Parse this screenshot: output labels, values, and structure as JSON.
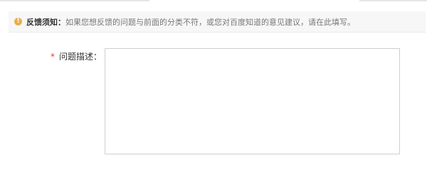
{
  "colors": {
    "notice_icon": "#e8b04a",
    "required_star": "#e03b3b"
  },
  "notice": {
    "icon": "exclamation-icon",
    "icon_glyph": "!",
    "title": "反馈须知：",
    "text": "如果您想反馈的问题与前面的分类不符，或您对百度知道的意见建议，请在此填写。"
  },
  "form": {
    "description": {
      "required_mark": "*",
      "label": "问题描述：",
      "value": "",
      "placeholder": ""
    }
  }
}
